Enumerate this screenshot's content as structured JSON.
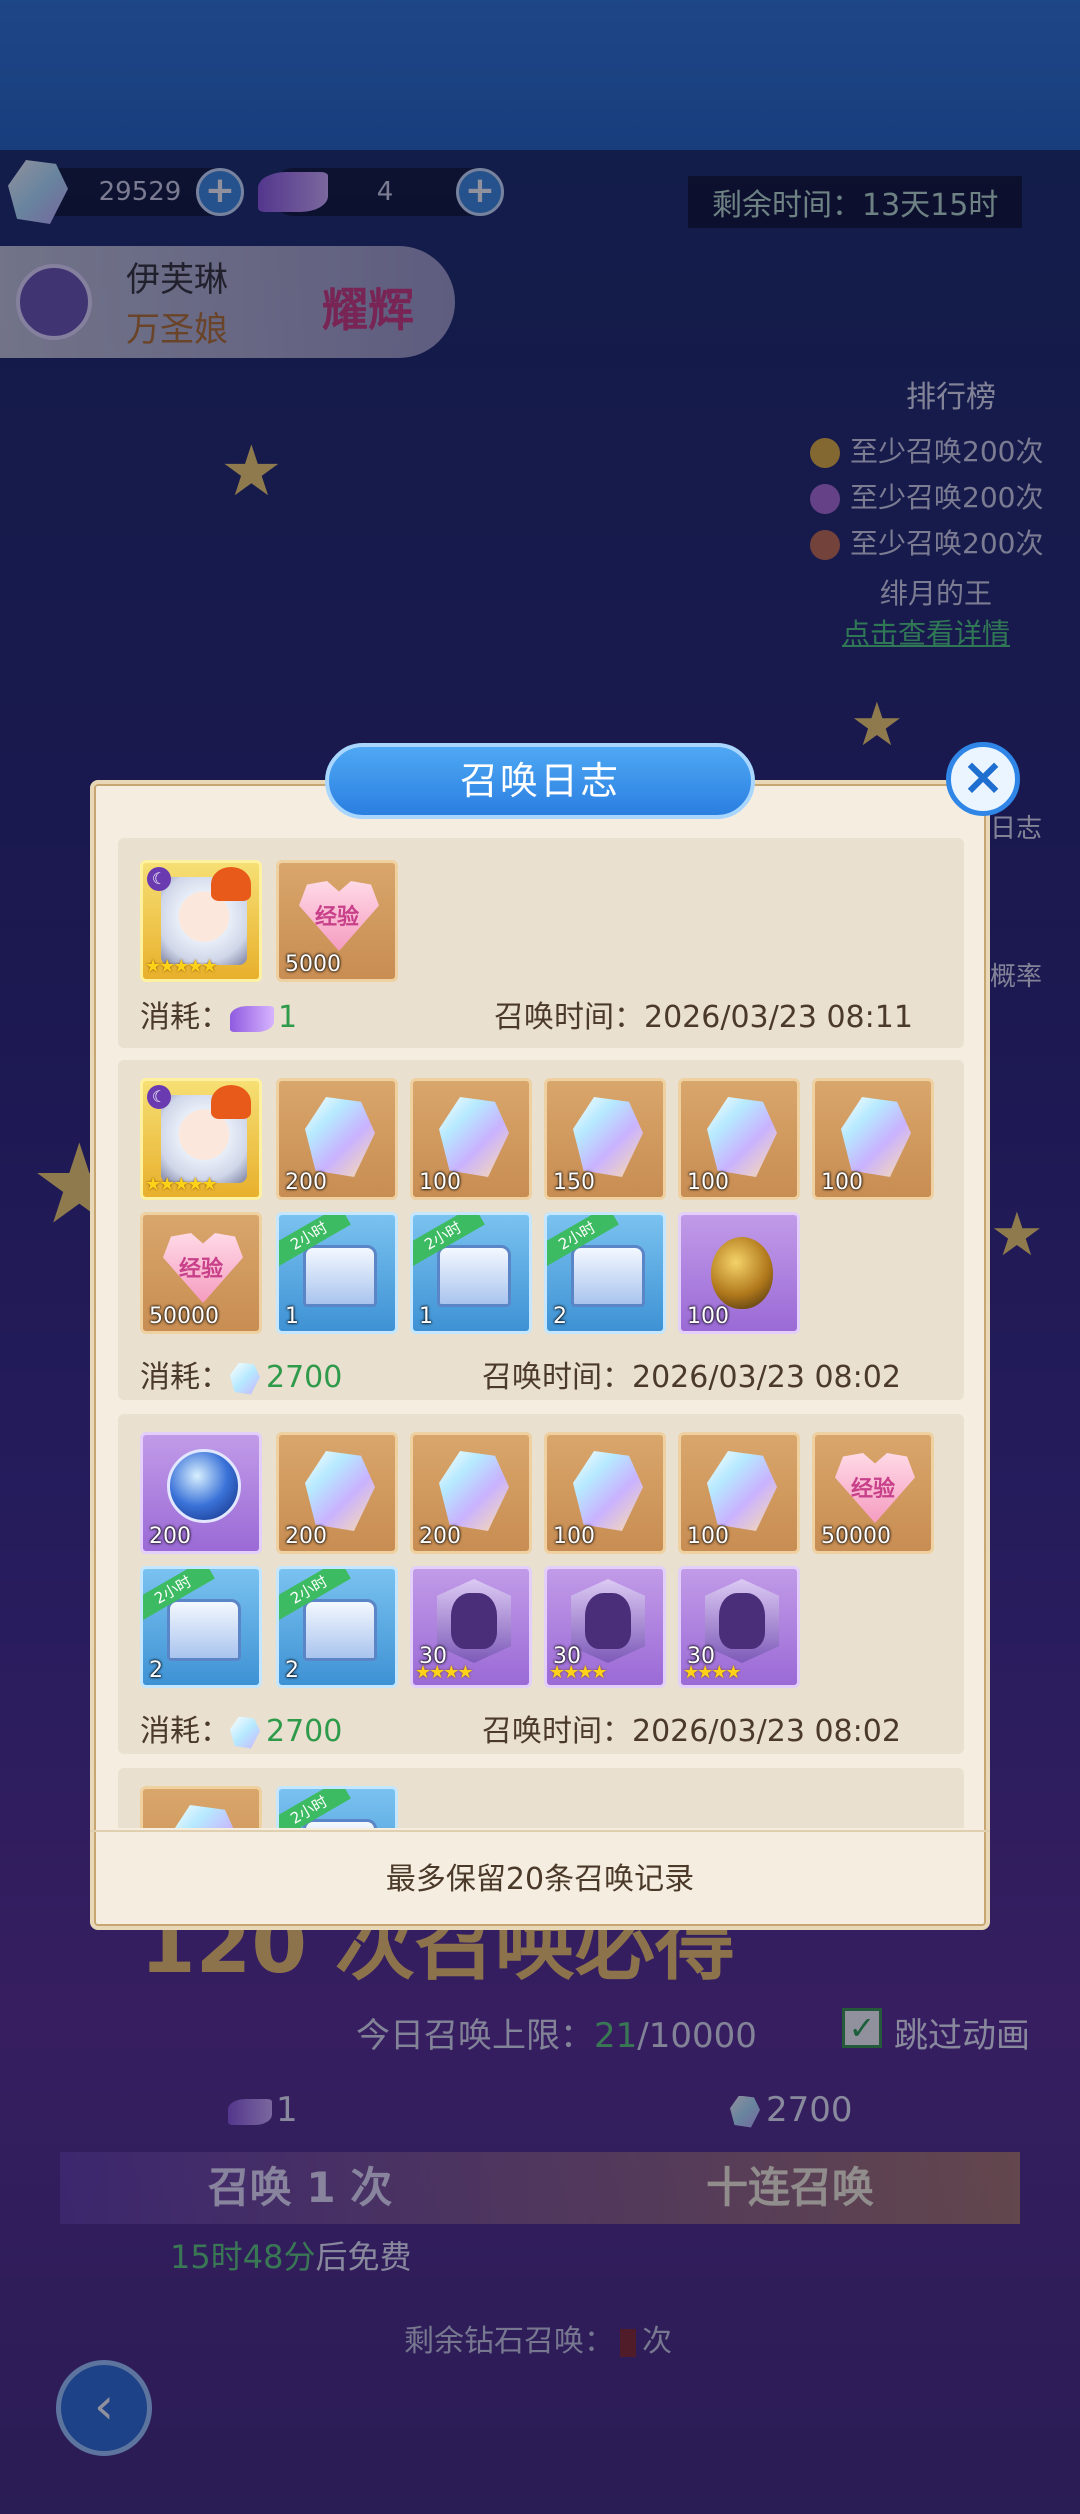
{
  "header": {
    "currency1": "29529",
    "currency2": "4",
    "timer": "剩余时间：13天15时"
  },
  "character": {
    "name": "伊芙琳",
    "subtitle": "万圣娘",
    "badge": "耀辉"
  },
  "ranking": {
    "title": "排行榜",
    "lines": [
      "至少召唤200次",
      "至少召唤200次",
      "至少召唤200次"
    ],
    "note": "绯月的王",
    "link": "点击查看详情"
  },
  "side": {
    "log": "日志",
    "rate": "概率"
  },
  "modal": {
    "title": "召唤日志",
    "close": "×",
    "footer": "最多保留20条召唤记录",
    "cost_label": "消耗：",
    "time_label": "召唤时间：",
    "entries": [
      {
        "cost": "1",
        "time": "2026/03/23 08:11",
        "items": [
          "",
          "5000"
        ]
      },
      {
        "cost": "2700",
        "time": "2026/03/23 08:02",
        "items": [
          "",
          "200",
          "100",
          "150",
          "100",
          "100",
          "50000",
          "1",
          "1",
          "2",
          "100"
        ]
      },
      {
        "cost": "2700",
        "time": "2026/03/23 08:02",
        "items": [
          "200",
          "200",
          "200",
          "100",
          "100",
          "50000",
          "2",
          "2",
          "30",
          "30",
          "30"
        ]
      }
    ],
    "tag_text": "2小时",
    "exp_text": "经验"
  },
  "bottom": {
    "big_text": "120 次召唤必得",
    "daily_limit_label": "今日召唤上限：",
    "daily_limit_used": "21",
    "daily_limit_total": "/10000",
    "skip": "跳过动画",
    "cost_single": "1",
    "cost_ten": "2700",
    "btn_single": "召唤 1 次",
    "btn_ten": "十连召唤",
    "free_time": "15时48分",
    "free_suffix": "后免费",
    "remain_label": "剩余钻石召唤：",
    "remain_suffix": "次"
  }
}
